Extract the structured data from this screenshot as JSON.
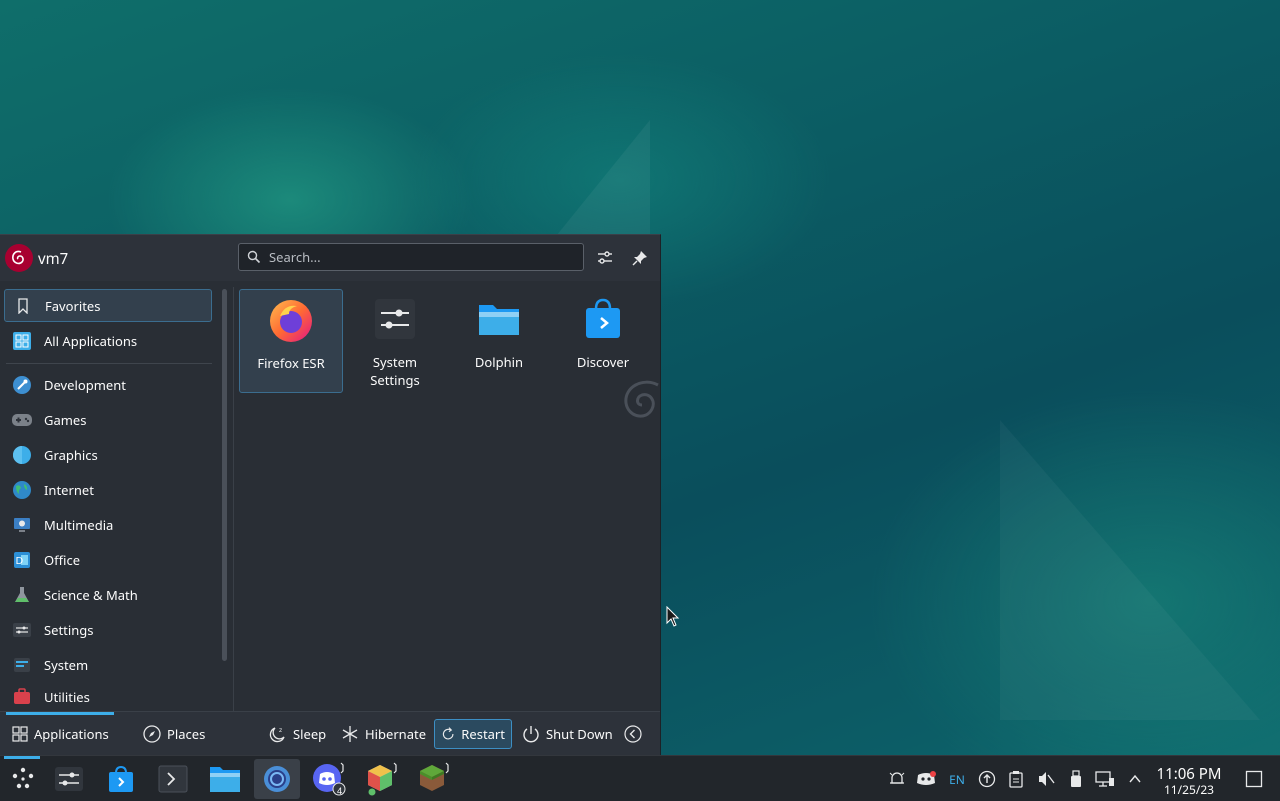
{
  "user": {
    "name": "vm7"
  },
  "search": {
    "placeholder": "Search..."
  },
  "sidebar": {
    "items": [
      {
        "label": "Favorites"
      },
      {
        "label": "All Applications"
      },
      {
        "label": "Development"
      },
      {
        "label": "Games"
      },
      {
        "label": "Graphics"
      },
      {
        "label": "Internet"
      },
      {
        "label": "Multimedia"
      },
      {
        "label": "Office"
      },
      {
        "label": "Science & Math"
      },
      {
        "label": "Settings"
      },
      {
        "label": "System"
      },
      {
        "label": "Utilities"
      }
    ]
  },
  "apps": [
    {
      "line1": "Firefox ESR",
      "line2": ""
    },
    {
      "line1": "System",
      "line2": "Settings"
    },
    {
      "line1": "Dolphin",
      "line2": ""
    },
    {
      "line1": "Discover",
      "line2": ""
    }
  ],
  "footer": {
    "applications": "Applications",
    "places": "Places",
    "sleep": "Sleep",
    "hibernate": "Hibernate",
    "restart": "Restart",
    "shutdown": "Shut Down"
  },
  "taskbar": {
    "discord_badge": "4",
    "lang": "EN",
    "time": "11:06 PM",
    "date": "11/25/23"
  },
  "colors": {
    "accent": "#3daee9",
    "debian_red": "#a80030"
  }
}
